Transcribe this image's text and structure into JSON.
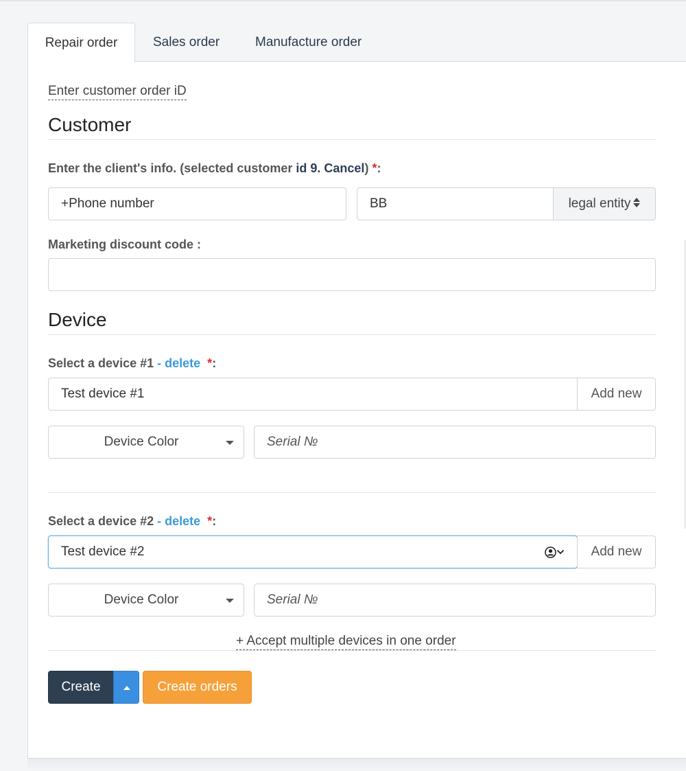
{
  "tabs": [
    {
      "label": "Repair order",
      "active": true
    },
    {
      "label": "Sales order",
      "active": false
    },
    {
      "label": "Manufacture order",
      "active": false
    }
  ],
  "customer_order_link": "Enter customer order iD",
  "customer": {
    "title": "Customer",
    "info_label_prefix": "Enter the client's info. (selected customer ",
    "info_label_id": "id 9.",
    "info_label_space": " ",
    "info_label_cancel": "Cancel",
    "info_label_suffix": ")",
    "required_mark": "*",
    "colon": ":",
    "phone_placeholder": "+Phone number",
    "name_value": "BB",
    "entity_select": "legal entity",
    "discount_label": "Marketing discount code :",
    "discount_value": ""
  },
  "device": {
    "title": "Device",
    "entries": [
      {
        "label": "Select a device #1",
        "delete_label": "- delete",
        "required_mark": "*",
        "colon": ":",
        "value": "Test device #1",
        "add_new": "Add new",
        "color_select": "Device Color",
        "serial_placeholder": "Serial №"
      },
      {
        "label": "Select a device #2",
        "delete_label": "- delete",
        "required_mark": "*",
        "colon": ":",
        "value": "Test device #2",
        "add_new": "Add new",
        "color_select": "Device Color",
        "serial_placeholder": "Serial №"
      }
    ],
    "accept_multiple_link": "+ Accept multiple devices in one order"
  },
  "actions": {
    "create_label": "Create",
    "create_orders_label": "Create orders"
  },
  "colors": {
    "primary_dark": "#2f3f52",
    "toggle_blue": "#3a8fe0",
    "orange": "#f6a03a",
    "link_blue": "#3b9ad9",
    "required_red": "#e02a2a"
  }
}
